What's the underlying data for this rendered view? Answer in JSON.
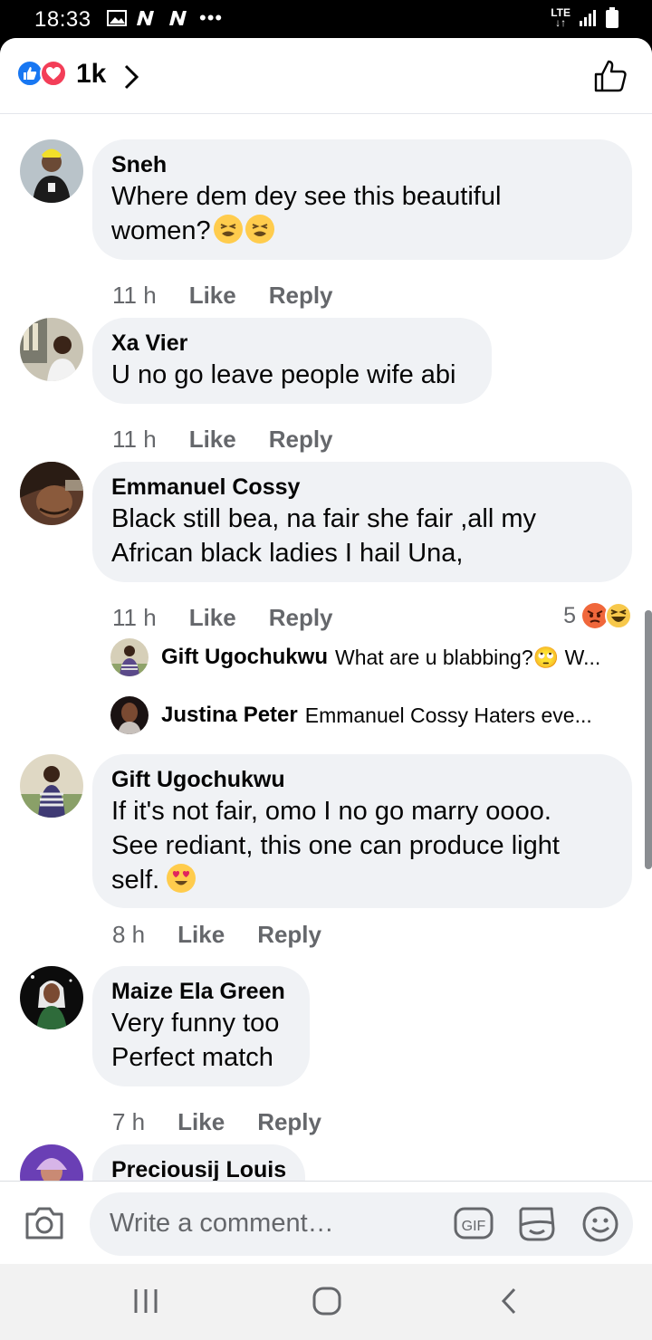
{
  "status_bar": {
    "time": "18:33",
    "network": "LTE",
    "dots": "•••"
  },
  "header": {
    "reaction_count": "1k",
    "reaction_icons": [
      "like-icon",
      "love-icon"
    ],
    "colors": {
      "like": "#1877f2",
      "love": "#f33e58"
    }
  },
  "comments": [
    {
      "author": "Sneh",
      "text": "Where dem dey see this beautiful\nwomen?",
      "emoji": [
        "tired-face-emoji",
        "tired-face-emoji"
      ],
      "time": "11 h",
      "like": "Like",
      "reply": "Reply"
    },
    {
      "author": "Xa Vier",
      "text": "U no go leave people wife abi",
      "time": "11 h",
      "like": "Like",
      "reply": "Reply"
    },
    {
      "author": "Emmanuel Cossy",
      "text": "Black  still bea, na fair she fair ,all my\nAfrican  black  ladies I hail Una,",
      "time": "11 h",
      "like": "Like",
      "reply": "Reply",
      "reaction_total": "5",
      "reactions": [
        "angry-icon",
        "haha-icon"
      ],
      "replies": [
        {
          "author": "Gift Ugochukwu",
          "text": "What are u blabbing?🙄 W..."
        },
        {
          "author": "Justina Peter",
          "text": "Emmanuel Cossy Haters eve..."
        }
      ]
    },
    {
      "author": "Gift Ugochukwu",
      "text": "If it's not fair, omo I no go marry oooo.\nSee rediant, this one can produce light\nself.",
      "emoji": [
        "heart-eyes-emoji"
      ],
      "time": "8 h",
      "like": "Like",
      "reply": "Reply"
    },
    {
      "author": "Maize Ela Green",
      "text": "Very funny too\nPerfect match",
      "time": "7 h",
      "like": "Like",
      "reply": "Reply"
    },
    {
      "author": "Preciousij Louis",
      "text": ""
    }
  ],
  "composer": {
    "placeholder": "Write a comment…",
    "gif_label": "GIF"
  }
}
